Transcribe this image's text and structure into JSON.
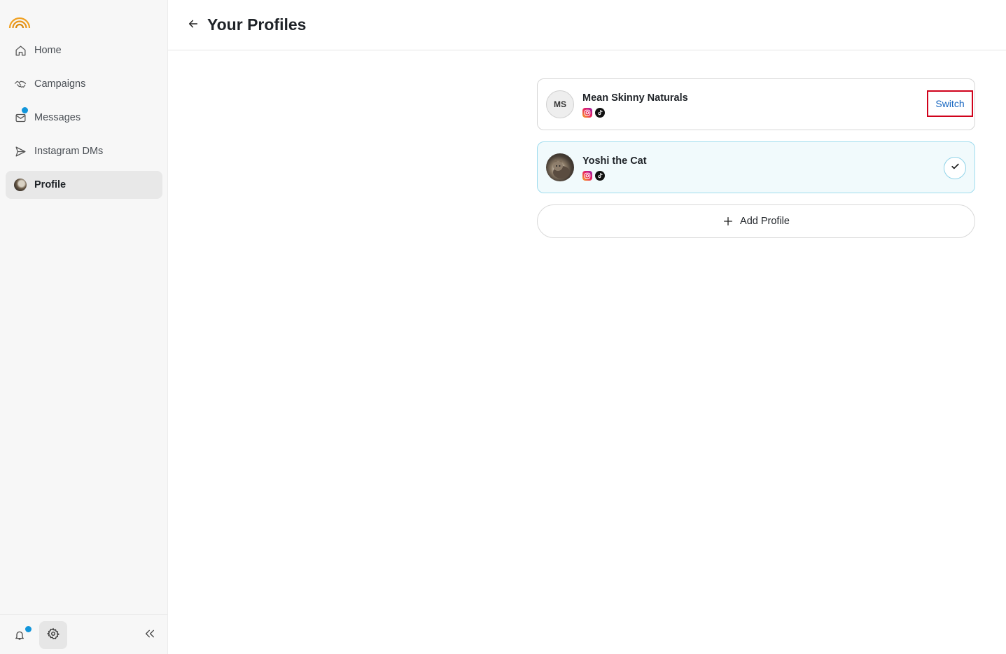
{
  "sidebar": {
    "items": [
      {
        "label": "Home",
        "icon": "home-icon"
      },
      {
        "label": "Campaigns",
        "icon": "handshake-icon"
      },
      {
        "label": "Messages",
        "icon": "mail-icon",
        "badge": true
      },
      {
        "label": "Instagram DMs",
        "icon": "send-icon"
      },
      {
        "label": "Profile",
        "icon": "avatar",
        "active": true
      }
    ],
    "bottom": {
      "notifications_icon": "bell-icon",
      "settings_icon": "gear-icon",
      "collapse_icon": "double-chevron-left-icon"
    }
  },
  "header": {
    "title": "Your Profiles",
    "back_icon": "arrow-left-icon"
  },
  "profiles": [
    {
      "name": "Mean Skinny Naturals",
      "initials": "MS",
      "socials": [
        "instagram-icon",
        "tiktok-icon"
      ],
      "action_label": "Switch",
      "selected": false
    },
    {
      "name": "Yoshi the Cat",
      "socials": [
        "instagram-icon",
        "tiktok-icon"
      ],
      "selected": true
    }
  ],
  "add_profile": {
    "label": "Add Profile"
  },
  "colors": {
    "accent_dot": "#1296db",
    "link": "#1565c0",
    "highlight_border": "#d0021b",
    "selected_bg": "#f1fafc",
    "logo": "#f0a020"
  }
}
